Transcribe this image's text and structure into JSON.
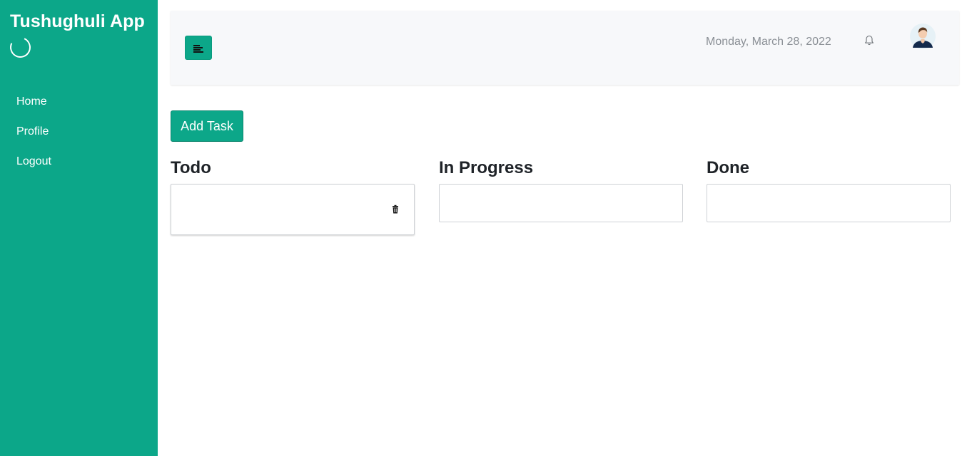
{
  "sidebar": {
    "brand": "Tushughuli App",
    "items": [
      {
        "label": "Home"
      },
      {
        "label": "Profile"
      },
      {
        "label": "Logout"
      }
    ]
  },
  "header": {
    "date": "Monday, March 28, 2022",
    "icons": {
      "toggle": "menu-align-left-icon",
      "notification": "bell-icon",
      "avatar": "user-avatar"
    }
  },
  "main": {
    "add_task_label": "Add Task",
    "columns": [
      {
        "title": "Todo"
      },
      {
        "title": "In Progress"
      },
      {
        "title": "Done"
      }
    ]
  },
  "colors": {
    "accent": "#0ca789",
    "topbar_bg": "#f7f8fa",
    "muted_text": "#8a8f95"
  }
}
